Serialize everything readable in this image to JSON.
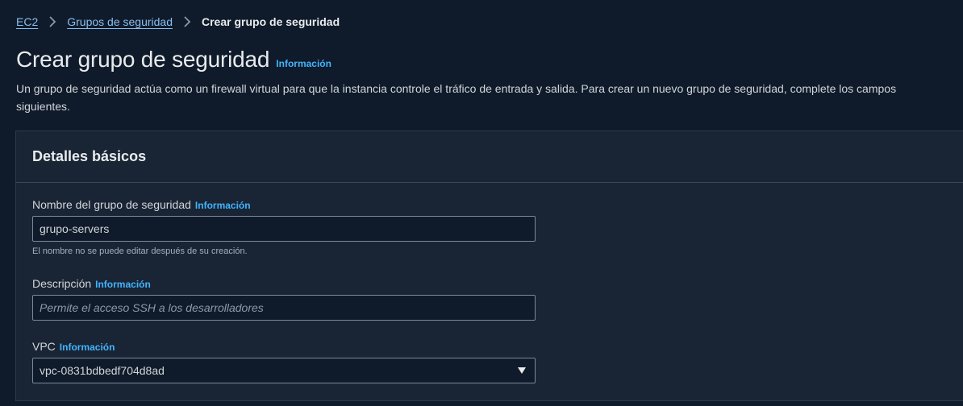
{
  "breadcrumb": {
    "items": [
      {
        "label": "EC2"
      },
      {
        "label": "Grupos de seguridad"
      }
    ],
    "current": "Crear grupo de seguridad"
  },
  "header": {
    "title": "Crear grupo de seguridad",
    "info_label": "Información",
    "description": "Un grupo de seguridad actúa como un firewall virtual para que la instancia controle el tráfico de entrada y salida. Para crear un nuevo grupo de seguridad, complete los campos siguientes."
  },
  "panel": {
    "title": "Detalles básicos",
    "fields": {
      "name": {
        "label": "Nombre del grupo de seguridad",
        "info_label": "Información",
        "value": "grupo-servers",
        "hint": "El nombre no se puede editar después de su creación."
      },
      "description": {
        "label": "Descripción",
        "info_label": "Información",
        "placeholder": "Permite el acceso SSH a los desarrolladores"
      },
      "vpc": {
        "label": "VPC",
        "info_label": "Información",
        "selected": "vpc-0831bdbedf704d8ad",
        "icon": "caret-down-icon"
      }
    }
  },
  "colors": {
    "background": "#0f1b2a",
    "panel": "#192534",
    "link": "#89bdf0",
    "info": "#42b4ff"
  }
}
